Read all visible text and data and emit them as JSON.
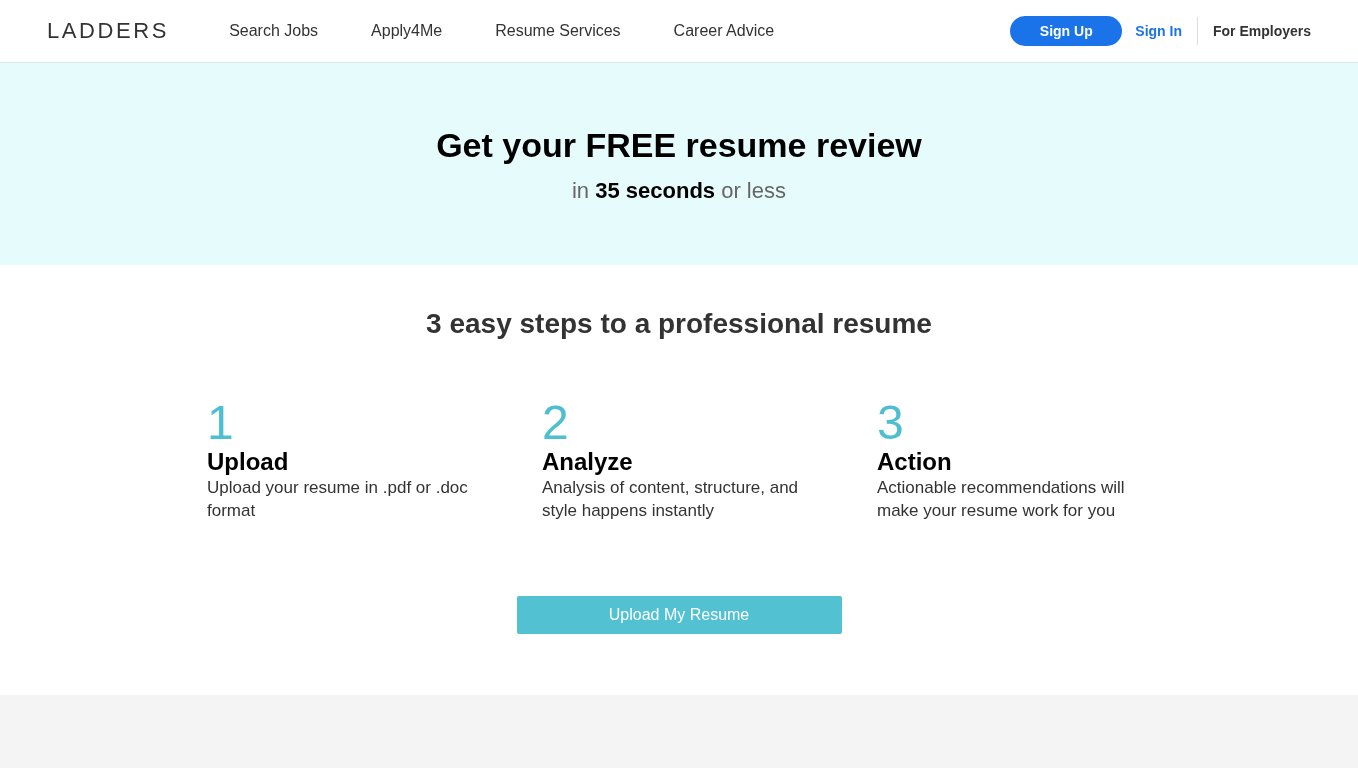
{
  "header": {
    "logo": "LADDERS",
    "nav": [
      "Search Jobs",
      "Apply4Me",
      "Resume Services",
      "Career Advice"
    ],
    "sign_up": "Sign Up",
    "sign_in": "Sign In",
    "for_employers": "For Employers"
  },
  "hero": {
    "title": "Get your FREE resume review",
    "subtitle": "in **35 seconds** or less"
  },
  "steps_section": {
    "heading": "3 easy steps to a professional resume",
    "steps": [
      {
        "number": "1",
        "title": "Upload",
        "description": "Upload your resume in .pdf or .doc format"
      },
      {
        "number": "2",
        "title": "Analyze",
        "description": "Analysis of content, structure, and style happens instantly"
      },
      {
        "number": "3",
        "title": "Action",
        "description": "Actionable recommendations will make your resume work for you"
      }
    ],
    "button": "Upload My Resume"
  }
}
